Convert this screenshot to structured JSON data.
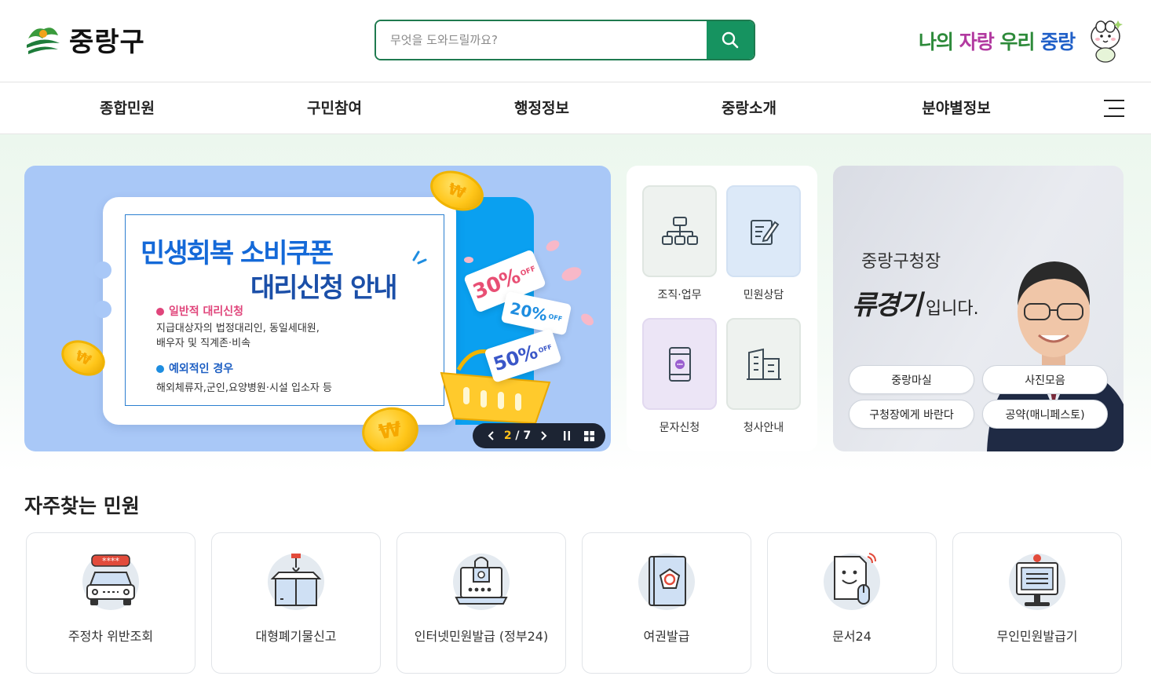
{
  "site": {
    "logo_text": "중랑구",
    "slogan": {
      "part1": "나의 ",
      "part2": "자랑",
      "part3": " 우리 ",
      "part4": "중랑"
    }
  },
  "search": {
    "placeholder": "무엇을 도와드릴까요?"
  },
  "nav": {
    "items": [
      "종합민원",
      "구민참여",
      "행정정보",
      "중랑소개",
      "분야별정보"
    ]
  },
  "banner": {
    "title_line1": "민생회복 소비쿠폰",
    "title_line2": "대리신청 안내",
    "section1_heading": "일반적 대리신청",
    "section1_line1": "지급대상자의 법정대리인, 동일세대원,",
    "section1_line2": "배우자 및 직계존·비속",
    "section2_heading": "예외적인 경우",
    "section2_line1": "해외체류자,군인,요양병원·시설 입소자 등",
    "coupon1": "30%",
    "coupon2": "20%",
    "coupon3": "50%",
    "coupon_off": "OFF",
    "coin_symbol": "₩",
    "pager_current": "2",
    "pager_sep": " / ",
    "pager_total": "7"
  },
  "quick_menu": [
    {
      "label": "조직·업무",
      "icon": "org-chart-icon",
      "bg": "#eef2ef"
    },
    {
      "label": "민원상담",
      "icon": "edit-document-icon",
      "bg": "#dce9f8"
    },
    {
      "label": "문자신청",
      "icon": "mobile-message-icon",
      "bg": "#ece5f6"
    },
    {
      "label": "청사안내",
      "icon": "building-icon",
      "bg": "#eef2ef"
    }
  ],
  "mayor": {
    "title": "중랑구청장",
    "signature": "류경기",
    "suffix": "입니다.",
    "buttons": [
      "중랑마실",
      "사진모음",
      "구청장에게 바란다",
      "공약(매니페스토)"
    ]
  },
  "frequent": {
    "title": "자주찾는 민원",
    "items": [
      {
        "label": "주정차 위반조회",
        "icon": "car-icon",
        "badge": "****"
      },
      {
        "label": "대형폐기물신고",
        "icon": "box-crane-icon"
      },
      {
        "label": "인터넷민원발급 (정부24)",
        "icon": "laptop-lock-icon"
      },
      {
        "label": "여권발급",
        "icon": "passport-icon"
      },
      {
        "label": "문서24",
        "icon": "document-smile-icon"
      },
      {
        "label": "무인민원발급기",
        "icon": "kiosk-icon"
      }
    ]
  },
  "colors": {
    "brand_green": "#169360",
    "accent_blue": "#1469d8",
    "accent_pink": "#e0457b",
    "coin_yellow": "#ffc61a"
  }
}
